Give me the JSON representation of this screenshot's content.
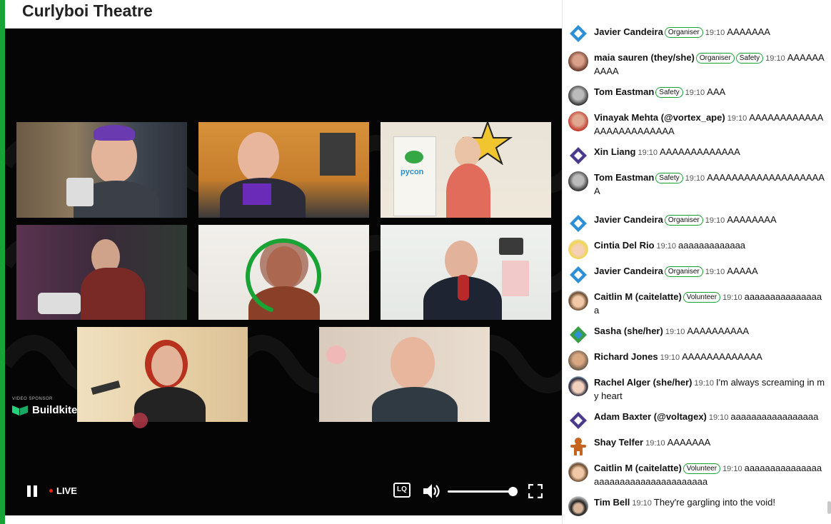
{
  "header": {
    "title": "Curlyboi Theatre"
  },
  "player": {
    "sponsor_label": "VIDEO SPONSOR",
    "sponsor_name": "Buildkite",
    "live_label": "LIVE",
    "quality_label": "LQ",
    "volume_fraction": 1.0,
    "loading_spinner_color": "#1aa335"
  },
  "chat": {
    "messages": [
      {
        "name": "Javier Candeira",
        "badges": [
          "Organiser"
        ],
        "time": "19:10",
        "text": "AAAAAAA",
        "avatar": "diamond-blue"
      },
      {
        "name": "maia sauren (they/she)",
        "badges": [
          "Organiser",
          "Safety"
        ],
        "time": "19:10",
        "text": "AAAAAAAAAA",
        "avatar": "photo-warm"
      },
      {
        "name": "Tom Eastman",
        "badges": [
          "Safety"
        ],
        "time": "19:10",
        "text": "AAA",
        "avatar": "photo-grey"
      },
      {
        "name": "Vinayak Mehta (@vortex_ape)",
        "badges": [],
        "time": "19:10",
        "text": "AAAAAAAAAAAAAAAAAAAAAAAAA",
        "avatar": "photo-red"
      },
      {
        "name": "Xin Liang",
        "badges": [],
        "time": "19:10",
        "text": "AAAAAAAAAAAAA",
        "avatar": "diamond-purple"
      },
      {
        "name": "Tom Eastman",
        "badges": [
          "Safety"
        ],
        "time": "19:10",
        "text": "AAAAAAAAAAAAAAAAAAAA",
        "avatar": "photo-grey"
      },
      {
        "name": "Javier Candeira",
        "badges": [
          "Organiser"
        ],
        "time": "19:10",
        "text": "AAAAAAAA",
        "avatar": "diamond-blue"
      },
      {
        "name": "Cintia Del Rio",
        "badges": [],
        "time": "19:10",
        "text": "aaaaaaaaaaaaa",
        "avatar": "cartoon-yellow"
      },
      {
        "name": "Javier Candeira",
        "badges": [
          "Organiser"
        ],
        "time": "19:10",
        "text": "AAAAA",
        "avatar": "diamond-blue"
      },
      {
        "name": "Caitlin M (caitelatte)",
        "badges": [
          "Volunteer"
        ],
        "time": "19:10",
        "text": "aaaaaaaaaaaaaaaa",
        "avatar": "cartoon-brown"
      },
      {
        "name": "Sasha (she/her)",
        "badges": [],
        "time": "19:10",
        "text": "AAAAAAAAAA",
        "avatar": "diamond-green"
      },
      {
        "name": "Richard Jones",
        "badges": [],
        "time": "19:10",
        "text": "AAAAAAAAAAAAA",
        "avatar": "photo-tan"
      },
      {
        "name": "Rachel Alger (she/her)",
        "badges": [],
        "time": "19:10",
        "text": "I'm always screaming in my heart",
        "avatar": "cartoon-blue"
      },
      {
        "name": "Adam Baxter (@voltagex)",
        "badges": [],
        "time": "19:10",
        "text": "aaaaaaaaaaaaaaaaa",
        "avatar": "diamond-purple"
      },
      {
        "name": "Shay Telfer",
        "badges": [],
        "time": "19:10",
        "text": "AAAAAAA",
        "avatar": "gingerbread"
      },
      {
        "name": "Caitlin M (caitelatte)",
        "badges": [
          "Volunteer"
        ],
        "time": "19:10",
        "text": "aaaaaaaaaaaaaaaaaaaaaaaaaaaaaaaaaaaaa",
        "avatar": "cartoon-brown"
      },
      {
        "name": "Tim Bell",
        "badges": [],
        "time": "19:10",
        "text": "They're gargling into the void!",
        "avatar": "hat-dark"
      }
    ]
  }
}
